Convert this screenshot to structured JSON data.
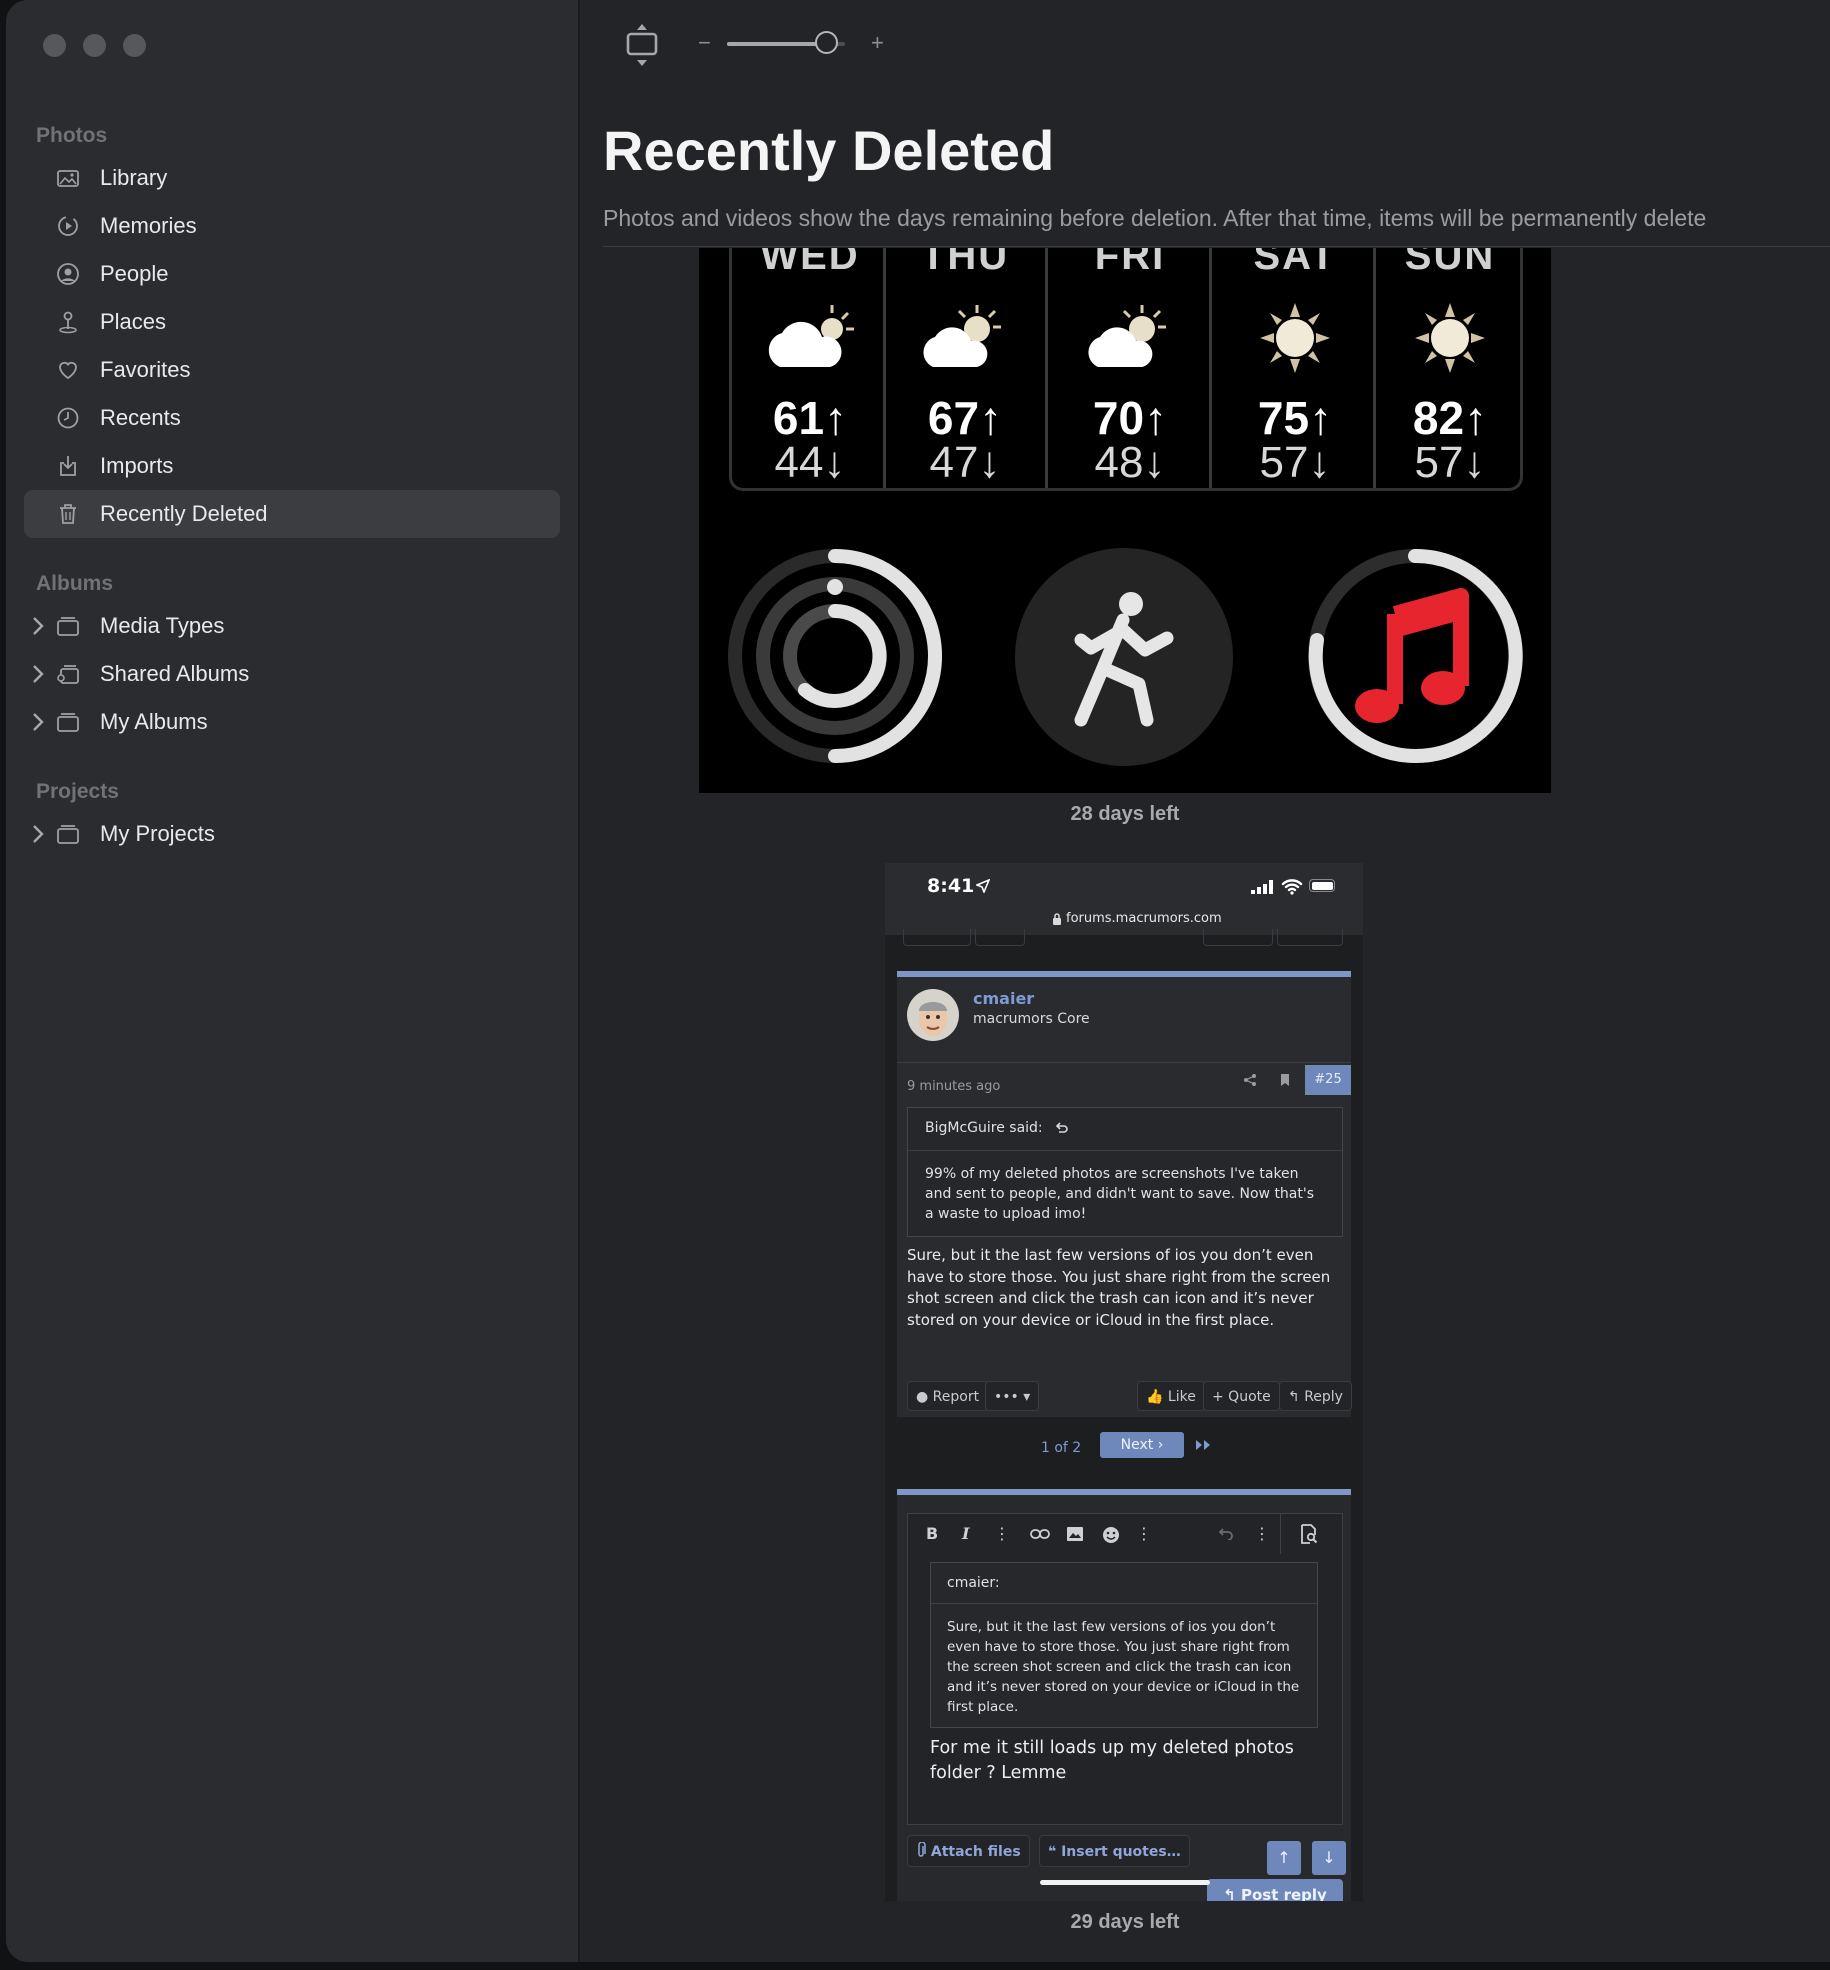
{
  "sidebar": {
    "sections": {
      "photos": "Photos",
      "albums": "Albums",
      "projects": "Projects"
    },
    "items": [
      {
        "label": "Library",
        "icon": "library-icon"
      },
      {
        "label": "Memories",
        "icon": "memories-icon"
      },
      {
        "label": "People",
        "icon": "people-icon"
      },
      {
        "label": "Places",
        "icon": "places-icon"
      },
      {
        "label": "Favorites",
        "icon": "heart-icon"
      },
      {
        "label": "Recents",
        "icon": "clock-icon"
      },
      {
        "label": "Imports",
        "icon": "import-icon"
      },
      {
        "label": "Recently Deleted",
        "icon": "trash-icon",
        "selected": true
      }
    ],
    "albums": [
      {
        "label": "Media Types",
        "icon": "album-stack-icon"
      },
      {
        "label": "Shared Albums",
        "icon": "shared-album-icon"
      },
      {
        "label": "My Albums",
        "icon": "album-stack-icon"
      }
    ],
    "projects": [
      {
        "label": "My Projects",
        "icon": "album-stack-icon"
      }
    ]
  },
  "toolbar": {
    "zoom_minus": "−",
    "zoom_plus": "+",
    "zoom_level": 0.85
  },
  "main": {
    "title": "Recently Deleted",
    "subtitle": "Photos and videos show the days remaining before deletion. After that time, items will be permanently delete",
    "items": [
      {
        "days_left": "28 days left"
      },
      {
        "days_left": "29 days left"
      }
    ]
  },
  "photo1": {
    "forecast": [
      {
        "day": "WED",
        "hi": "61↑",
        "lo": "44↓",
        "icon": "cloudy-sun-icon"
      },
      {
        "day": "THU",
        "hi": "67↑",
        "lo": "47↓",
        "icon": "partly-cloudy-icon"
      },
      {
        "day": "FRI",
        "hi": "70↑",
        "lo": "48↓",
        "icon": "partly-cloudy-icon"
      },
      {
        "day": "SAT",
        "hi": "75↑",
        "lo": "57↓",
        "icon": "sun-icon"
      },
      {
        "day": "SUN",
        "hi": "82↑",
        "lo": "57↓",
        "icon": "sun-icon"
      }
    ],
    "complications": [
      "activity-rings-icon",
      "workout-runner-icon",
      "music-note-icon"
    ]
  },
  "photo2": {
    "status": {
      "time": "8:41",
      "url": "forums.macrumors.com"
    },
    "post": {
      "username": "cmaier",
      "user_title": "macrumors Core",
      "time": "9 minutes ago",
      "post_number": "#25",
      "quote_author": "BigMcGuire said:",
      "quote_text": "99% of my deleted photos are screenshots I've taken and sent to people, and didn't want to save. Now that's a waste to upload imo!",
      "body": "Sure, but it the last few versions of ios you don’t even have to store those. You just share right from the screen shot screen and click the trash can icon and it’s never stored on your device or iCloud in the first place.",
      "actions": {
        "report": "Report",
        "more": "•••",
        "like": "Like",
        "quote": "+ Quote",
        "reply": "Reply"
      }
    },
    "pagination": {
      "page": "1 of 2",
      "next": "Next"
    },
    "editor": {
      "quote_author": "cmaier:",
      "quote_text": "Sure, but it the last few versions of ios you don’t even have to store those. You just share right from the screen shot screen and click the trash can icon and it’s never stored on your device or iCloud in the first place.",
      "reply_text": "For me it still loads up my deleted photos folder ? Lemme",
      "attach": "Attach files",
      "insert_quotes": "Insert quotes…",
      "post_reply": "Post reply"
    }
  }
}
